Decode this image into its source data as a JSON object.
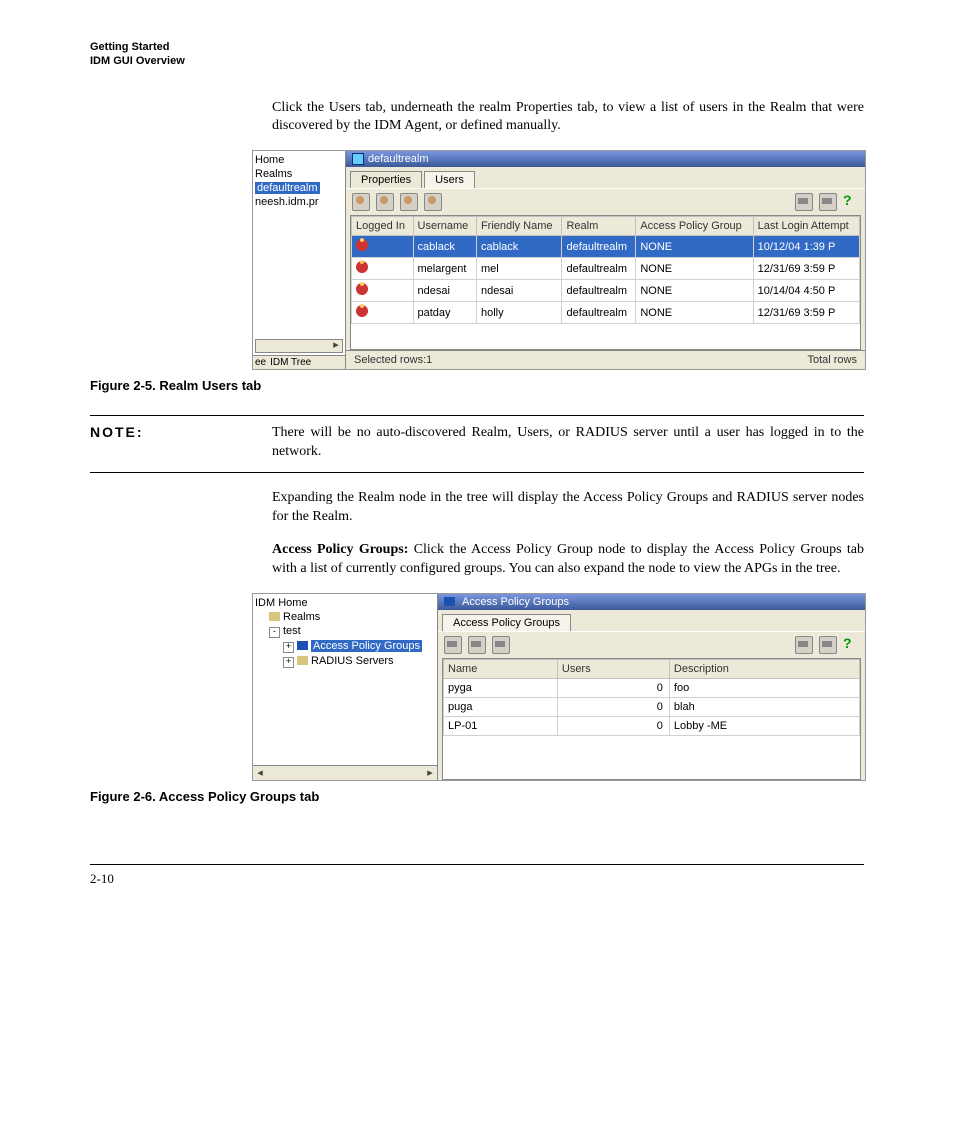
{
  "header": {
    "line1": "Getting Started",
    "line2": "IDM GUI Overview"
  },
  "para1": "Click the Users tab, underneath the realm Properties tab, to view a list of users in the Realm that were discovered by the IDM Agent, or defined manually.",
  "figure1": {
    "caption": "Figure 2-5. Realm Users tab",
    "tree": {
      "home": "Home",
      "realms": "Realms",
      "realm": "defaultrealm",
      "server": "neesh.idm.pr",
      "tab1": "ee",
      "tab2": "IDM Tree"
    },
    "title": "defaultrealm",
    "tabs": {
      "properties": "Properties",
      "users": "Users"
    },
    "columns": [
      "Logged In",
      "Username",
      "Friendly Name",
      "Realm",
      "Access Policy Group",
      "Last Login Attempt"
    ],
    "rows": [
      {
        "username": "cablack",
        "friendly": "cablack",
        "realm": "defaultrealm",
        "apg": "NONE",
        "last": "10/12/04 1:39 P",
        "selected": true
      },
      {
        "username": "melargent",
        "friendly": "mel",
        "realm": "defaultrealm",
        "apg": "NONE",
        "last": "12/31/69 3:59 P",
        "selected": false
      },
      {
        "username": "ndesai",
        "friendly": "ndesai",
        "realm": "defaultrealm",
        "apg": "NONE",
        "last": "10/14/04 4:50 P",
        "selected": false
      },
      {
        "username": "patday",
        "friendly": "holly",
        "realm": "defaultrealm",
        "apg": "NONE",
        "last": "12/31/69 3:59 P",
        "selected": false
      }
    ],
    "status": {
      "left": "Selected rows:1",
      "right": "Total rows"
    }
  },
  "note": {
    "label": "NOTE:",
    "text": "There will be no auto-discovered Realm, Users, or RADIUS server until a user has logged in to the network."
  },
  "para2": "Expanding the Realm node in the tree will display the Access Policy Groups and RADIUS server nodes for the Realm.",
  "para3_lead": "Access Policy Groups:",
  "para3_rest": " Click the Access Policy Group node to display the Access Policy Groups tab with a list of currently configured groups. You can also expand the node to view the APGs in the tree.",
  "figure2": {
    "caption": "Figure 2-6. Access Policy Groups tab",
    "tree": {
      "home": "IDM Home",
      "realms": "Realms",
      "test": "test",
      "apg": "Access Policy Groups",
      "radius": "RADIUS Servers"
    },
    "title": "Access Policy Groups",
    "tab": "Access Policy Groups",
    "columns": [
      "Name",
      "Users",
      "Description"
    ],
    "rows": [
      {
        "name": "pyga",
        "users": "0",
        "desc": "foo"
      },
      {
        "name": "puga",
        "users": "0",
        "desc": "blah"
      },
      {
        "name": "LP-01",
        "users": "0",
        "desc": "Lobby -ME"
      }
    ]
  },
  "pagenum": "2-10"
}
